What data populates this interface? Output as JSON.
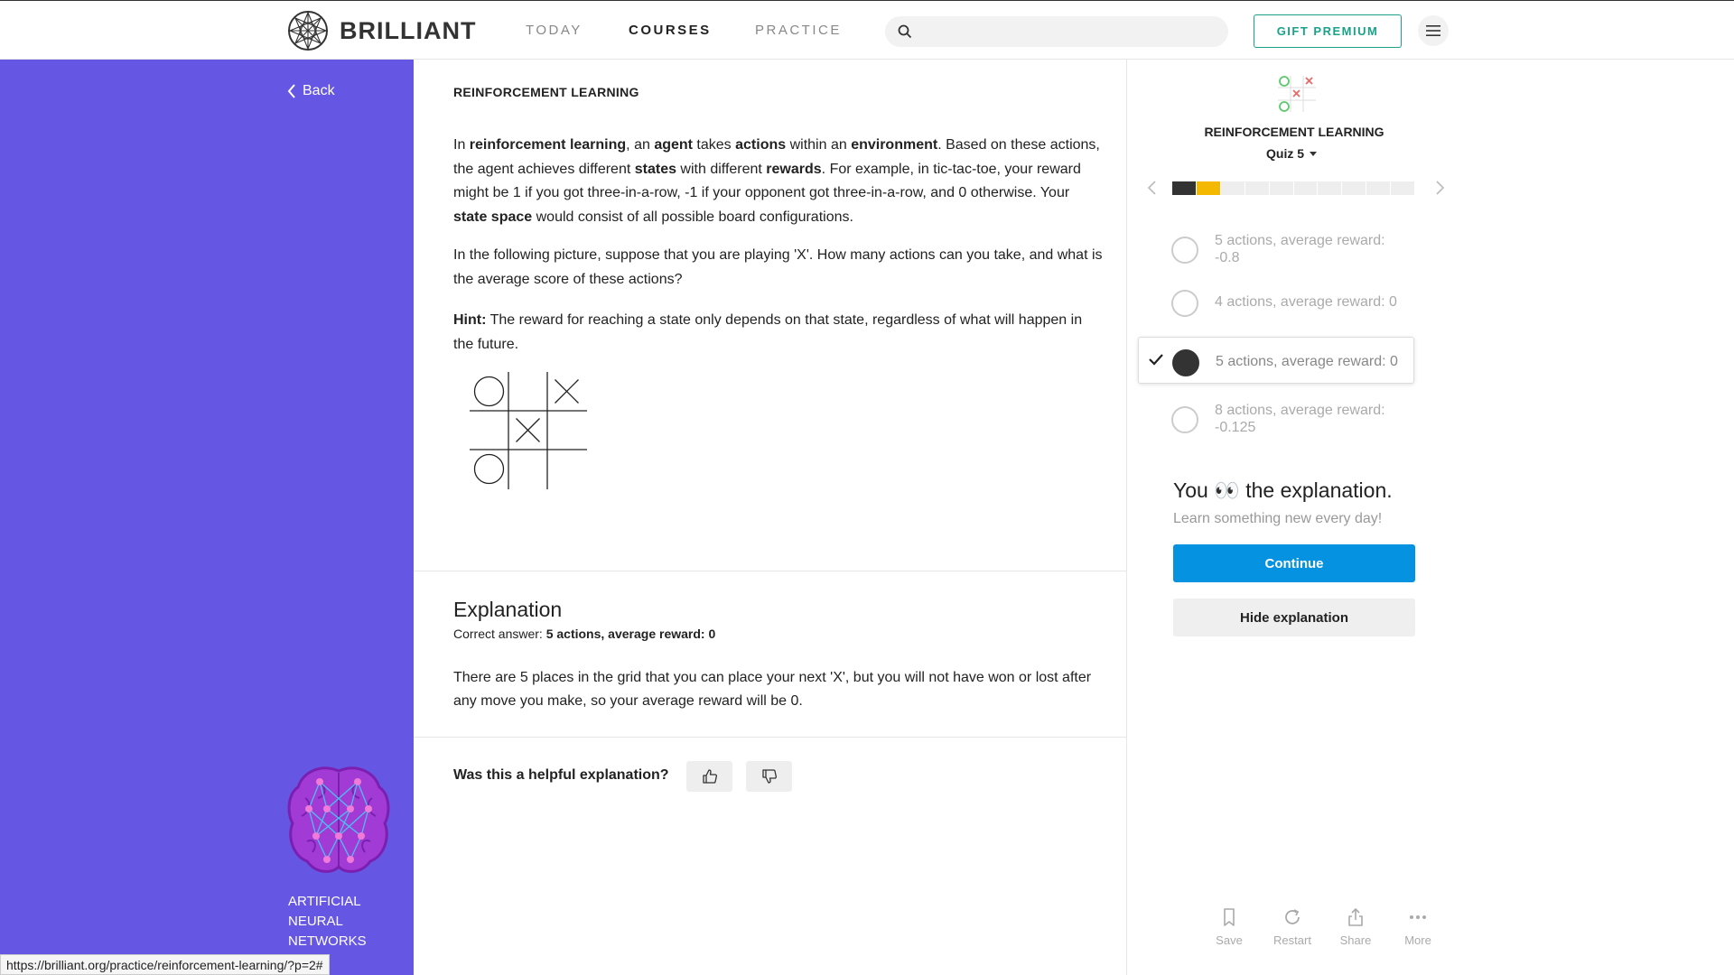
{
  "nav": {
    "brand": "BRILLIANT",
    "links": [
      {
        "label": "TODAY",
        "active": false
      },
      {
        "label": "COURSES",
        "active": true
      },
      {
        "label": "PRACTICE",
        "active": false
      }
    ],
    "search_placeholder": "",
    "gift_label": "GIFT PREMIUM"
  },
  "sidebar": {
    "back_label": "Back",
    "course_name": "ARTIFICIAL NEURAL NETWORKS",
    "status_url": "https://brilliant.org/practice/reinforcement-learning/?p=2#"
  },
  "content": {
    "title": "REINFORCEMENT LEARNING",
    "intro_html_parts": {
      "p1": "In <b>reinforcement learning</b>, an <b>agent</b> takes <b>actions</b> within an <b>environment</b>. Based on these actions, the agent achieves different <b>states</b> with different <b>rewards</b>. For example, in tic-tac-toe, your reward might be 1 if you got three-in-a-row, -1 if your opponent got three-in-a-row, and 0 otherwise. Your <b>state space</b> would consist of all possible board configurations.",
      "p2": "In the following picture, suppose that you are playing 'X'. How many actions can you take, and what is the average score of these actions?",
      "p3": "<b>Hint:</b> The reward for reaching a state only depends on that state, regardless of what will happen in the future."
    },
    "board": [
      [
        "O",
        "",
        "X"
      ],
      [
        "",
        "X",
        ""
      ],
      [
        "O",
        "",
        ""
      ]
    ],
    "explanation": {
      "title": "Explanation",
      "correct_prefix": "Correct answer: ",
      "correct_answer": "5 actions, average reward: 0",
      "text": "There are 5 places in the grid that you can place your next 'X', but you will not have won or lost after any move you make, so your average reward will be 0."
    },
    "helpful_question": "Was this a helpful explanation?"
  },
  "quiz": {
    "course_title": "REINFORCEMENT LEARNING",
    "quiz_label": "Quiz 5",
    "progress_segments": [
      "#333333",
      "#f5b800",
      "#eeeeee",
      "#eeeeee",
      "#eeeeee",
      "#eeeeee",
      "#eeeeee",
      "#eeeeee",
      "#eeeeee",
      "#eeeeee"
    ],
    "options": [
      {
        "label": "5 actions, average reward: -0.8",
        "selected": false
      },
      {
        "label": "4 actions, average reward: 0",
        "selected": false
      },
      {
        "label": "5 actions, average reward: 0",
        "selected": true
      },
      {
        "label": "8 actions, average reward: -0.125",
        "selected": false
      }
    ],
    "you_before": "You",
    "you_emoji": "👀",
    "you_after": "the explanation.",
    "learn": "Learn something new every day!",
    "continue_label": "Continue",
    "hide_label": "Hide explanation",
    "tools": [
      {
        "label": "Save",
        "icon": "bookmark-icon"
      },
      {
        "label": "Restart",
        "icon": "restart-icon"
      },
      {
        "label": "Share",
        "icon": "share-icon"
      },
      {
        "label": "More",
        "icon": "more-icon"
      }
    ]
  },
  "colors": {
    "sidebar": "#6557e3",
    "accent_teal": "#1aa189",
    "continue_blue": "#0592e0",
    "progress_active": "#f5b800"
  }
}
